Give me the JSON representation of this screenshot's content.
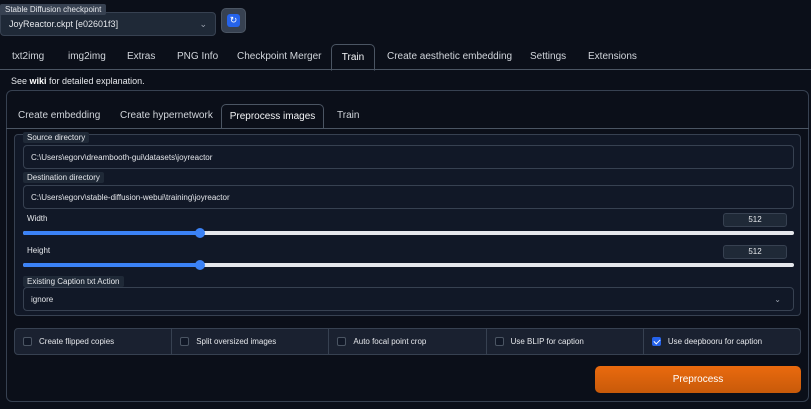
{
  "checkpoint": {
    "label": "Stable Diffusion checkpoint",
    "value": "JoyReactor.ckpt [e02601f3]",
    "refresh_icon": "refresh-icon"
  },
  "main_tabs": [
    {
      "label": "txt2img"
    },
    {
      "label": "img2img"
    },
    {
      "label": "Extras"
    },
    {
      "label": "PNG Info"
    },
    {
      "label": "Checkpoint Merger"
    },
    {
      "label": "Train",
      "active": true
    },
    {
      "label": "Create aesthetic embedding"
    },
    {
      "label": "Settings"
    },
    {
      "label": "Extensions"
    }
  ],
  "wiki": {
    "prefix": "See ",
    "link": "wiki",
    "suffix": " for detailed explanation."
  },
  "sub_tabs": [
    {
      "label": "Create embedding"
    },
    {
      "label": "Create hypernetwork"
    },
    {
      "label": "Preprocess images",
      "active": true
    },
    {
      "label": "Train"
    }
  ],
  "preprocess": {
    "source_label": "Source directory",
    "source_value": "C:\\Users\\egorv\\dreambooth-gui\\datasets\\joyreactor",
    "dest_label": "Destination directory",
    "dest_value": "C:\\Users\\egorv\\stable-diffusion-webui\\training\\joyreactor",
    "width_label": "Width",
    "width_value": "512",
    "width_fraction": 0.23,
    "height_label": "Height",
    "height_value": "512",
    "height_fraction": 0.23,
    "caption_label": "Existing Caption txt Action",
    "caption_value": "ignore"
  },
  "checkboxes": [
    {
      "label": "Create flipped copies",
      "checked": false
    },
    {
      "label": "Split oversized images",
      "checked": false
    },
    {
      "label": "Auto focal point crop",
      "checked": false
    },
    {
      "label": "Use BLIP for caption",
      "checked": false
    },
    {
      "label": "Use deepbooru for caption",
      "checked": true
    }
  ],
  "preprocess_button": "Preprocess",
  "colors": {
    "accent": "#3b82f6",
    "primary_button": "#ea6a0e",
    "background": "#0b0f19"
  }
}
